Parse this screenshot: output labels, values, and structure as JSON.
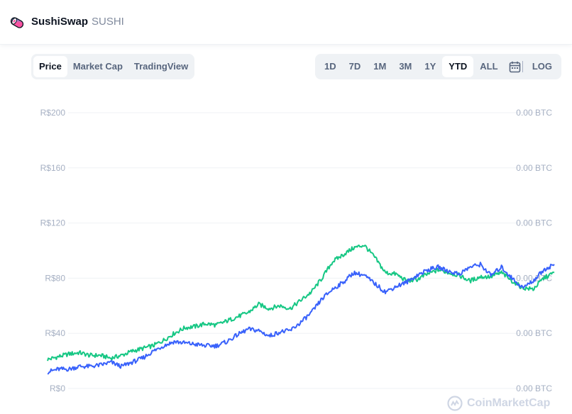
{
  "header": {
    "coin_name": "SushiSwap",
    "coin_symbol": "SUSHI"
  },
  "view_tabs": [
    {
      "label": "Price",
      "active": true
    },
    {
      "label": "Market Cap",
      "active": false
    },
    {
      "label": "TradingView",
      "active": false
    }
  ],
  "range_tabs": [
    {
      "label": "1D",
      "active": false
    },
    {
      "label": "7D",
      "active": false
    },
    {
      "label": "1M",
      "active": false
    },
    {
      "label": "3M",
      "active": false
    },
    {
      "label": "1Y",
      "active": false
    },
    {
      "label": "YTD",
      "active": true
    },
    {
      "label": "ALL",
      "active": false
    }
  ],
  "log_label": "LOG",
  "watermark": "CoinMarketCap",
  "colors": {
    "green_series": "#16c784",
    "blue_series": "#3861fb",
    "grid": "#eff2f5",
    "axis_text": "#a6b0c3"
  },
  "chart_data": {
    "type": "line",
    "y_left_ticks": [
      "R$0",
      "R$40",
      "R$80",
      "R$120",
      "R$160",
      "R$200"
    ],
    "y_right_ticks": [
      "0.00 BTC",
      "0.00 BTC",
      "0.00 BTC",
      "0.00 BTC",
      "0.00 BTC",
      "0.00 BTC"
    ],
    "ylim": [
      0,
      200
    ],
    "x": [
      0,
      1,
      2,
      3,
      4,
      5,
      6,
      7,
      8,
      9,
      10,
      11,
      12,
      13,
      14,
      15,
      16,
      17,
      18,
      19,
      20,
      21,
      22,
      23,
      24,
      25,
      26,
      27,
      28,
      29,
      30,
      31,
      32,
      33,
      34,
      35,
      36,
      37,
      38,
      39,
      40,
      41,
      42,
      43,
      44,
      45,
      46,
      47,
      48
    ],
    "grid": true,
    "legend": "none",
    "series": [
      {
        "color": "green",
        "values": [
          21,
          23,
          25,
          26,
          24,
          24,
          22,
          24,
          27,
          29,
          31,
          35,
          40,
          44,
          45,
          47,
          46,
          49,
          52,
          55,
          61,
          58,
          60,
          58,
          64,
          70,
          80,
          92,
          97,
          102,
          104,
          95,
          84,
          83,
          78,
          79,
          83,
          86,
          84,
          82,
          78,
          81,
          81,
          84,
          78,
          73,
          72,
          80,
          84
        ]
      },
      {
        "color": "blue",
        "values": [
          12,
          14,
          14,
          16,
          16,
          17,
          19,
          16,
          19,
          22,
          27,
          31,
          34,
          33,
          32,
          31,
          31,
          34,
          39,
          43,
          42,
          38,
          41,
          42,
          48,
          55,
          65,
          72,
          77,
          84,
          82,
          76,
          70,
          74,
          77,
          82,
          86,
          88,
          85,
          83,
          88,
          90,
          82,
          88,
          80,
          73,
          78,
          86,
          90
        ]
      }
    ]
  }
}
